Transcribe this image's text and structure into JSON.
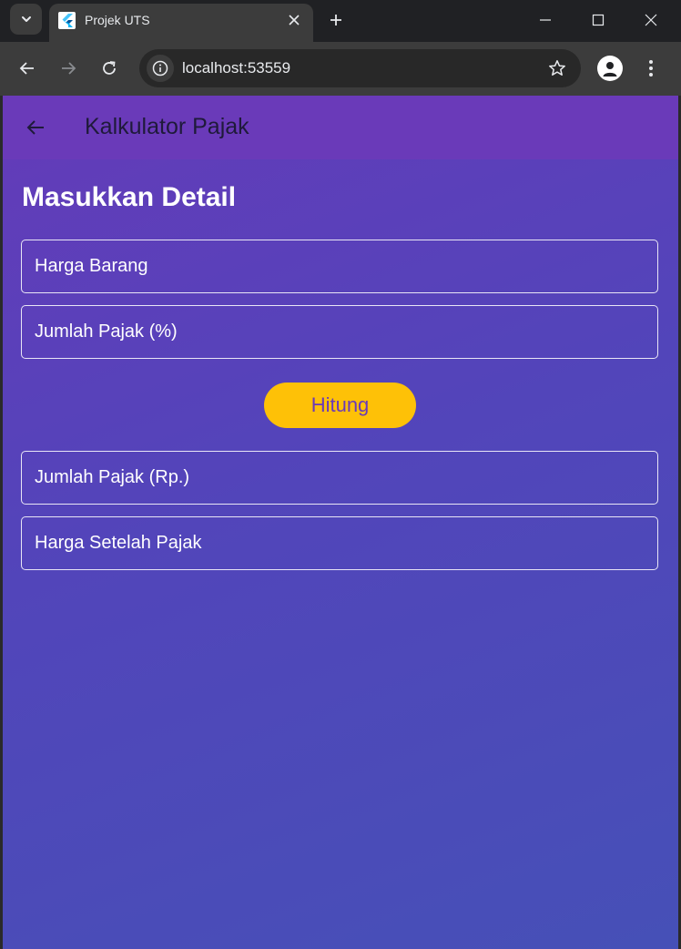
{
  "browser": {
    "tab": {
      "title": "Projek UTS"
    },
    "address_bar": {
      "url": "localhost:53559"
    }
  },
  "app": {
    "appbar": {
      "title": "Kalkulator Pajak"
    },
    "section_title": "Masukkan Detail",
    "fields": {
      "harga_barang": {
        "label": "Harga Barang"
      },
      "jumlah_pajak_persen": {
        "label": "Jumlah Pajak (%)"
      },
      "jumlah_pajak_rp": {
        "label": "Jumlah Pajak (Rp.)"
      },
      "harga_setelah_pajak": {
        "label": "Harga Setelah Pajak"
      }
    },
    "hitung_button": {
      "label": "Hitung"
    }
  },
  "colors": {
    "appbar": "#6a3ab9",
    "gradient_start": "#643bb9",
    "gradient_end": "#4650b7",
    "button_bg": "#fec107",
    "button_text": "#6a3ab9"
  }
}
